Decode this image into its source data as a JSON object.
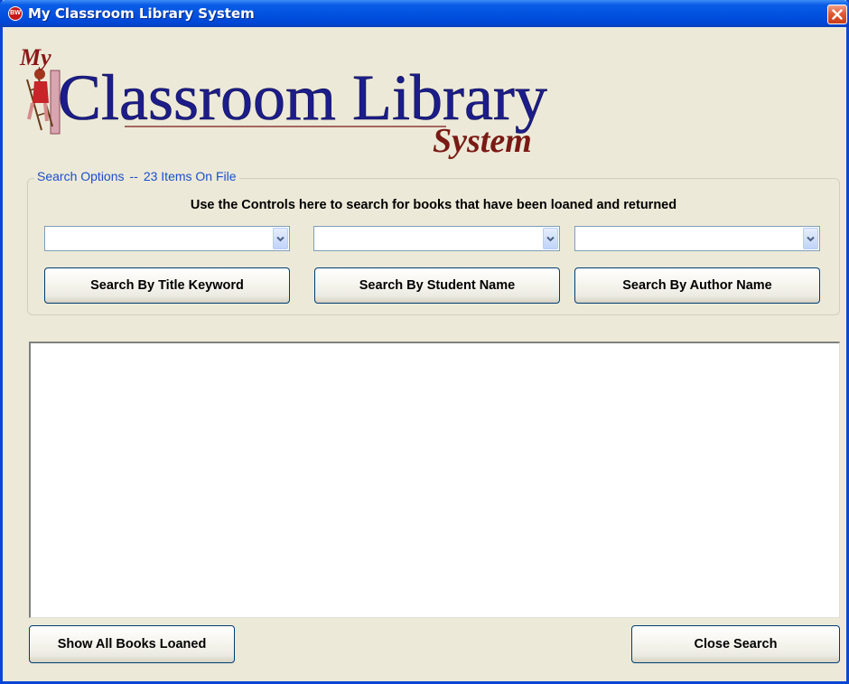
{
  "window": {
    "icon_text": "BW",
    "title": "My Classroom Library System"
  },
  "logo": {
    "my": "My",
    "main": "Classroom Library",
    "sub": "System"
  },
  "search_options": {
    "legend_label": "Search Options",
    "legend_separator": "--",
    "legend_count": "23 Items On File",
    "instructions": "Use the Controls here to search for books that have been loaned and returned",
    "title_combo_value": "",
    "student_combo_value": "",
    "author_combo_value": "",
    "title_button": "Search By Title Keyword",
    "student_button": "Search By Student Name",
    "author_button": "Search By Author Name"
  },
  "results": {
    "items": []
  },
  "footer": {
    "show_all_button": "Show All Books Loaned",
    "close_button": "Close Search"
  },
  "colors": {
    "titlebar": "#0353e0",
    "window_bg": "#ece9d8",
    "legend_text": "#1a4fcd",
    "logo_navy": "#1c1d8a",
    "logo_maroon": "#7a1a14"
  }
}
